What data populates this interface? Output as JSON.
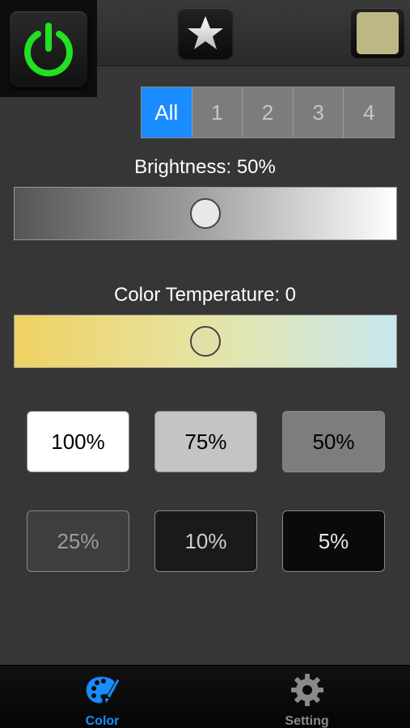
{
  "header": {
    "power_color": "#22e022",
    "current_color": "#bdb786"
  },
  "zones": {
    "items": [
      "All",
      "1",
      "2",
      "3",
      "4"
    ],
    "selected": "All"
  },
  "brightness": {
    "label": "Brightness: 50%",
    "value": 0.5
  },
  "temperature": {
    "label": "Color Temperature: 0",
    "value": 0.5
  },
  "presets": [
    {
      "label": "100%",
      "bg": "#ffffff",
      "fg": "#000000"
    },
    {
      "label": "75%",
      "bg": "#c4c4c4",
      "fg": "#000000"
    },
    {
      "label": "50%",
      "bg": "#7d7d7d",
      "fg": "#000000"
    },
    {
      "label": "25%",
      "bg": "#3e3e3e",
      "fg": "#9c9c9c"
    },
    {
      "label": "10%",
      "bg": "#1a1a1a",
      "fg": "#cfcfcf"
    },
    {
      "label": "5%",
      "bg": "#0a0a0a",
      "fg": "#e8e8e8"
    }
  ],
  "tabs": [
    {
      "label": "Color",
      "icon": "palette-icon",
      "active": true,
      "color": "#1a8cff"
    },
    {
      "label": "Setting",
      "icon": "gear-icon",
      "active": false,
      "color": "#8a8a8a"
    }
  ]
}
